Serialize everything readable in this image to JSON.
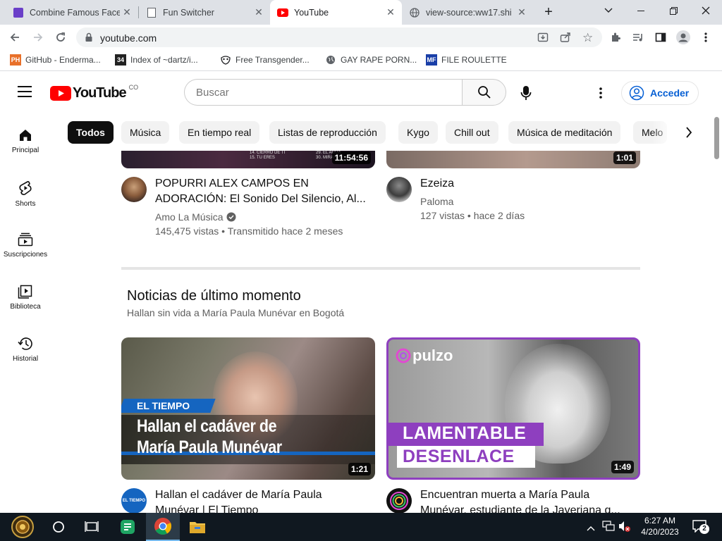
{
  "browser": {
    "tabs": [
      {
        "title": "Combine Famous Faces",
        "active": false
      },
      {
        "title": "Fun Switcher",
        "active": false
      },
      {
        "title": "YouTube",
        "active": true
      },
      {
        "title": "view-source:ww17.shi",
        "active": false
      }
    ],
    "address": "youtube.com",
    "bookmarks": [
      {
        "label": "GitHub - Enderma...",
        "icon": "PH"
      },
      {
        "label": "Index of ~dartz/i...",
        "icon": "34"
      },
      {
        "label": "Free Transgender...",
        "icon": "mask"
      },
      {
        "label": "GAY RAPE PORN...",
        "icon": "globe"
      },
      {
        "label": "FILE ROULETTE",
        "icon": "MF"
      }
    ]
  },
  "youtube": {
    "logo_text": "YouTube",
    "country": "CO",
    "search_placeholder": "Buscar",
    "signin_label": "Acceder",
    "sidebar": [
      {
        "label": "Principal",
        "icon": "home-icon"
      },
      {
        "label": "Shorts",
        "icon": "shorts-icon"
      },
      {
        "label": "Suscripciones",
        "icon": "subscriptions-icon"
      },
      {
        "label": "Biblioteca",
        "icon": "library-icon"
      },
      {
        "label": "Historial",
        "icon": "history-icon"
      }
    ],
    "chips": [
      "Todos",
      "Música",
      "En tiempo real",
      "Listas de reproducción",
      "Kygo",
      "Chill out",
      "Música de meditación",
      "Melo"
    ],
    "top_videos": [
      {
        "duration": "11:54:56",
        "title_line1": "POPURRI ALEX CAMPOS EN",
        "title_line2": "ADORACIÓN: El Sonido Del Silencio, Al...",
        "channel": "Amo La Música",
        "verified": true,
        "stats": "145,475 vistas • Transmitido hace 2 meses",
        "thumb_text_left": "14. CIERRO DE TI\n15. TU ERES",
        "thumb_text_right": "29. EL AGUA\n30. MIRAR"
      },
      {
        "duration": "1:01",
        "title_line1": "Ezeiza",
        "channel": "Paloma",
        "stats": "127 vistas • hace 2 días"
      }
    ],
    "section": {
      "title": "Noticias de último momento",
      "subtitle": "Hallan sin vida a María Paula Munévar en Bogotá"
    },
    "news_videos": [
      {
        "duration": "1:21",
        "badge": "EL TIEMPO",
        "headline1": "Hallan el cadáver de",
        "headline2": "María Paula Munévar",
        "title_line1": "Hallan el cadáver de María Paula",
        "title_line2": "Munévar | El Tiempo",
        "avatar_text": "EL TIEMPO"
      },
      {
        "duration": "1:49",
        "brand": "pulzo",
        "headline1": "LAMENTABLE",
        "headline2": "DESENLACE",
        "title_line1": "Encuentran muerta a María Paula",
        "title_line2": "Munévar, estudiante de la Javeriana q..."
      }
    ]
  },
  "taskbar": {
    "time": "6:27 AM",
    "date": "4/20/2023",
    "notifications": "2"
  },
  "colors": {
    "yt_red": "#ff0000",
    "link_blue": "#065fd4",
    "tiempo_blue": "#1565c0",
    "pulzo_purple": "#8e3fbf"
  }
}
